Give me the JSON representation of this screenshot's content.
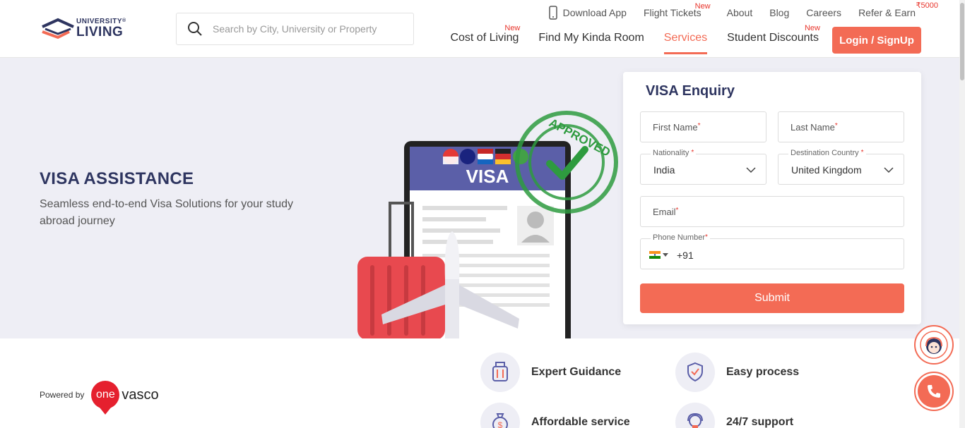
{
  "brand": {
    "line1": "UNIVERSITY",
    "line2": "LIVING",
    "registered": "®",
    "colors": {
      "navy": "#2e3560",
      "coral": "#f36b55"
    }
  },
  "search": {
    "placeholder": "Search by City, University or Property"
  },
  "top_links": [
    {
      "label": "Download App",
      "icon": "phone-icon"
    },
    {
      "label": "Flight Tickets",
      "badge": "New"
    },
    {
      "label": "About"
    },
    {
      "label": "Blog"
    },
    {
      "label": "Careers"
    },
    {
      "label": "Refer & Earn",
      "badge": "₹5000"
    }
  ],
  "main_nav": [
    {
      "label": "Cost of Living",
      "badge": "New"
    },
    {
      "label": "Find My Kinda Room"
    },
    {
      "label": "Services",
      "active": true
    },
    {
      "label": "Student Discounts",
      "badge": "New"
    }
  ],
  "login_label": "Login / SignUp",
  "hero": {
    "title": "VISA ASSISTANCE",
    "subtitle": "Seamless end-to-end Visa Solutions for your study abroad journey",
    "illustration": {
      "card_title": "VISA",
      "stamp_text": "APPROVED"
    }
  },
  "form": {
    "title": "VISA Enquiry",
    "first_name_placeholder": "First Name",
    "last_name_placeholder": "Last Name",
    "nationality": {
      "label": "Nationality",
      "value": "India"
    },
    "destination": {
      "label": "Destination Country",
      "value": "United Kingdom"
    },
    "email_placeholder": "Email",
    "phone": {
      "label": "Phone Number",
      "dial_code": "+91"
    },
    "required_mark": "*",
    "submit_label": "Submit"
  },
  "powered_by": {
    "label": "Powered by",
    "brand_one": "one",
    "brand_rest": "vasco"
  },
  "features": [
    {
      "label": "Expert Guidance",
      "icon": "luggage-icon"
    },
    {
      "label": "Easy process",
      "icon": "shield-hands-icon"
    },
    {
      "label": "Affordable service",
      "icon": "money-bag-icon"
    },
    {
      "label": "24/7 support",
      "icon": "support-agent-icon"
    }
  ],
  "floating": {
    "chat": "chatbot-icon",
    "call": "phone-call-icon"
  }
}
